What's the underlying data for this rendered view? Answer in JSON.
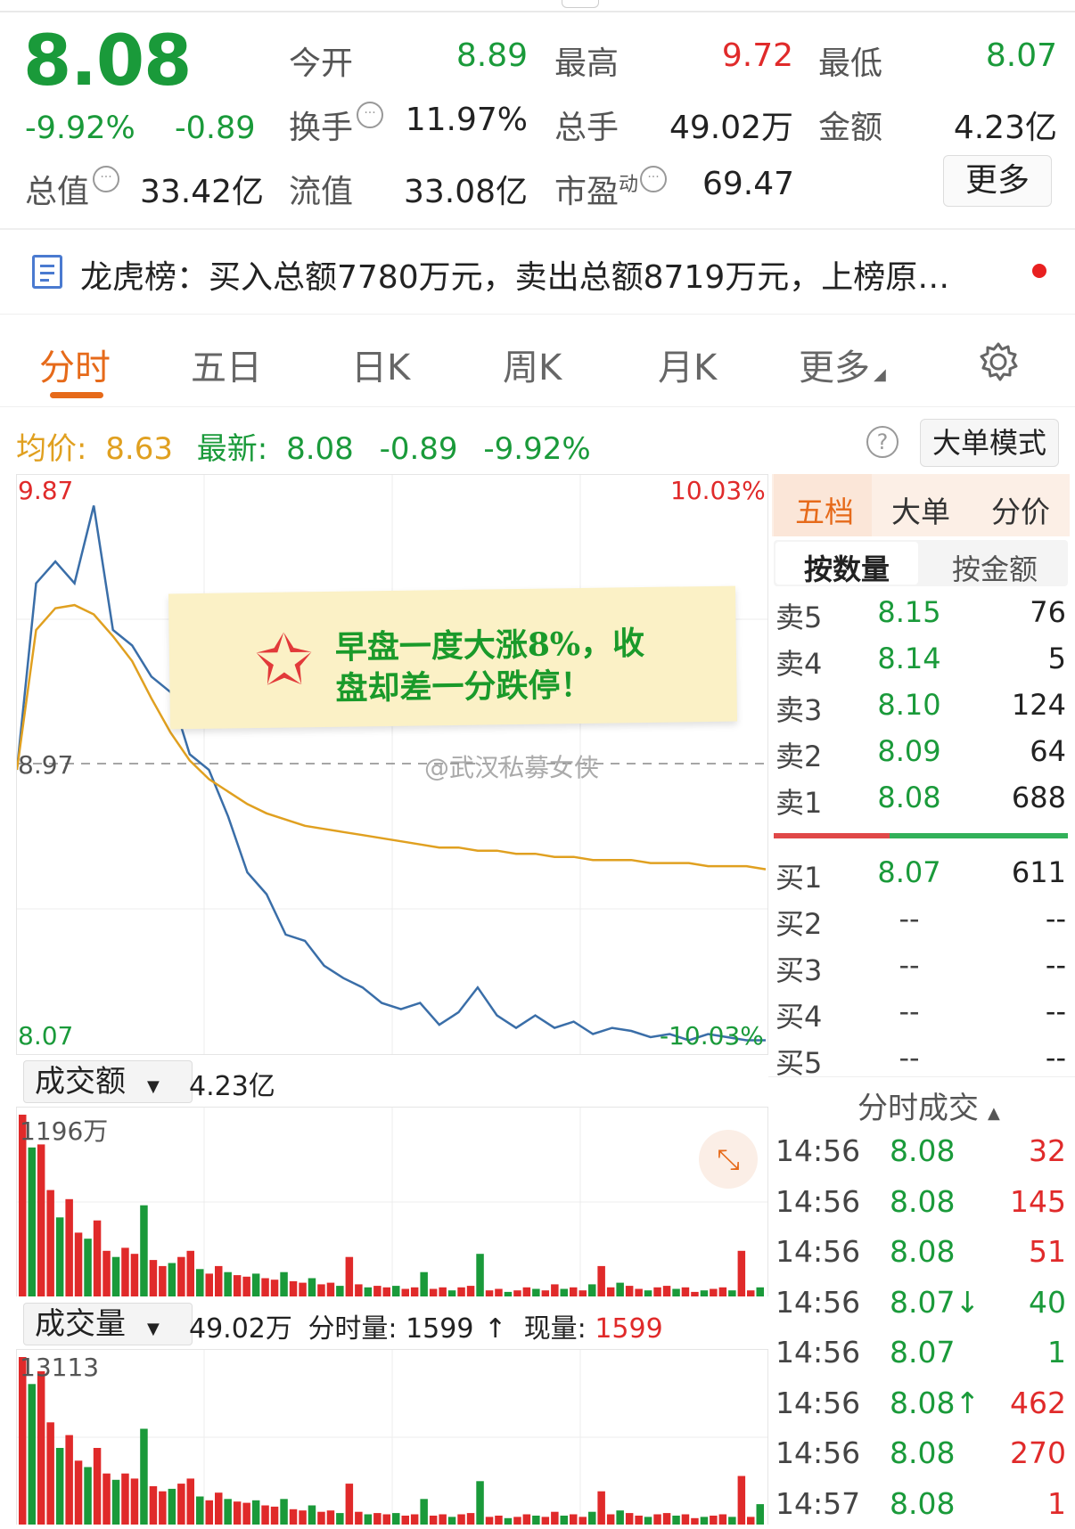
{
  "quote": {
    "price": "8.08",
    "change_pct": "-9.92%",
    "change": "-0.89",
    "open_label": "今开",
    "open": "8.89",
    "high_label": "最高",
    "high": "9.72",
    "low_label": "最低",
    "low": "8.07",
    "turnover_label": "换手",
    "turnover": "11.97%",
    "volume_label": "总手",
    "volume": "49.02万",
    "amount_label": "金额",
    "amount": "4.23亿",
    "mktcap_label": "总值",
    "mktcap": "33.42亿",
    "float_label": "流值",
    "float_cap": "33.08亿",
    "pe_label": "市盈",
    "pe_sup": "动",
    "pe": "69.47",
    "more_label": "更多"
  },
  "banner": {
    "text": "龙虎榜：买入总额7780万元，卖出总额8719万元，上榜原…"
  },
  "tabs": [
    "分时",
    "五日",
    "日K",
    "周K",
    "月K",
    "更多"
  ],
  "stats_line": {
    "avg_label": "均价:",
    "avg": "8.63",
    "latest_label": "最新:",
    "latest": "8.08",
    "change": "-0.89",
    "change_pct": "-9.92%",
    "mode_btn": "大单模式"
  },
  "chart_labels": {
    "top_price": "9.87",
    "mid_price": "8.97",
    "bottom_price": "8.07",
    "top_pct": "10.03%",
    "bottom_pct": "-10.03%",
    "watermark": "@武汉私募女侠"
  },
  "sticky_note": {
    "line1": "早盘一度大涨8%，收",
    "line2": "盘却差一分跌停！"
  },
  "amount_panel": {
    "selector": "成交额",
    "value": "4.23亿",
    "max_label": "1196万"
  },
  "volume_panel": {
    "selector": "成交量",
    "value": "49.02万",
    "tick_vol_label": "分时量:",
    "tick_vol": "1599",
    "now_label": "现量:",
    "now_vol": "1599",
    "max_label": "13113"
  },
  "side_tabs": [
    "五档",
    "大单",
    "分价"
  ],
  "side_subtabs": [
    "按数量",
    "按金额"
  ],
  "order_book": {
    "asks": [
      {
        "label": "卖5",
        "price": "8.15",
        "qty": "76"
      },
      {
        "label": "卖4",
        "price": "8.14",
        "qty": "5"
      },
      {
        "label": "卖3",
        "price": "8.10",
        "qty": "124"
      },
      {
        "label": "卖2",
        "price": "8.09",
        "qty": "64"
      },
      {
        "label": "卖1",
        "price": "8.08",
        "qty": "688"
      }
    ],
    "bids": [
      {
        "label": "买1",
        "price": "8.07",
        "qty": "611"
      },
      {
        "label": "买2",
        "price": "--",
        "qty": "--"
      },
      {
        "label": "买3",
        "price": "--",
        "qty": "--"
      },
      {
        "label": "买4",
        "price": "--",
        "qty": "--"
      },
      {
        "label": "买5",
        "price": "--",
        "qty": "--"
      }
    ]
  },
  "trades_title": "分时成交",
  "trades": [
    {
      "time": "14:56",
      "price": "8.08",
      "qty": "32",
      "qty_color": "red"
    },
    {
      "time": "14:56",
      "price": "8.08",
      "qty": "145",
      "qty_color": "red"
    },
    {
      "time": "14:56",
      "price": "8.08",
      "qty": "51",
      "qty_color": "red"
    },
    {
      "time": "14:56",
      "price": "8.07↓",
      "qty": "40",
      "qty_color": "green"
    },
    {
      "time": "14:56",
      "price": "8.07",
      "qty": "1",
      "qty_color": "green"
    },
    {
      "time": "14:56",
      "price": "8.08↑",
      "qty": "462",
      "qty_color": "red"
    },
    {
      "time": "14:56",
      "price": "8.08",
      "qty": "270",
      "qty_color": "red"
    },
    {
      "time": "14:57",
      "price": "8.08",
      "qty": "1",
      "qty_color": "red"
    }
  ],
  "colors": {
    "up": "#e02a2a",
    "down": "#1a9a3a",
    "avg_line": "#e0a020",
    "price_line": "#3a6ea8",
    "accent": "#e66a1a"
  },
  "chart_data": {
    "type": "line",
    "title": "",
    "ylim": [
      8.07,
      9.87
    ],
    "prev_close": 8.97,
    "series": [
      {
        "name": "price",
        "values": [
          8.95,
          9.55,
          9.62,
          9.55,
          9.8,
          9.4,
          9.35,
          9.25,
          9.2,
          9.0,
          8.95,
          8.8,
          8.62,
          8.55,
          8.42,
          8.4,
          8.32,
          8.28,
          8.25,
          8.2,
          8.18,
          8.2,
          8.13,
          8.17,
          8.25,
          8.16,
          8.12,
          8.16,
          8.12,
          8.14,
          8.1,
          8.12,
          8.11,
          8.09,
          8.1,
          8.08,
          8.1,
          8.09,
          8.08,
          8.08
        ]
      },
      {
        "name": "avg",
        "values": [
          8.95,
          9.4,
          9.47,
          9.48,
          9.45,
          9.38,
          9.3,
          9.18,
          9.07,
          8.98,
          8.92,
          8.88,
          8.84,
          8.81,
          8.79,
          8.77,
          8.76,
          8.75,
          8.74,
          8.73,
          8.72,
          8.71,
          8.7,
          8.7,
          8.69,
          8.69,
          8.68,
          8.68,
          8.67,
          8.67,
          8.66,
          8.66,
          8.66,
          8.65,
          8.65,
          8.65,
          8.64,
          8.64,
          8.64,
          8.63
        ]
      }
    ],
    "amount_bars": [
      1196,
      980,
      1000,
      700,
      520,
      640,
      420,
      380,
      500,
      300,
      260,
      320,
      280,
      600,
      240,
      200,
      220,
      260,
      300,
      180,
      150,
      200,
      160,
      140,
      130,
      150,
      120,
      110,
      160,
      100,
      90,
      120,
      80,
      90,
      70,
      260,
      80,
      60,
      70,
      60,
      70,
      50,
      60,
      160,
      50,
      60,
      40,
      60,
      70,
      280,
      40,
      50,
      30,
      40,
      60,
      50,
      40,
      80,
      50,
      60,
      40,
      80,
      200,
      60,
      90,
      70,
      50,
      40,
      60,
      70,
      50,
      60,
      30,
      40,
      50,
      60,
      40,
      300,
      40,
      60
    ],
    "volume_bars": [
      13113,
      11000,
      12000,
      8000,
      6000,
      7000,
      5000,
      4500,
      6000,
      4000,
      3500,
      4000,
      3600,
      7500,
      3000,
      2600,
      2800,
      3200,
      3600,
      2200,
      1900,
      2500,
      2000,
      1800,
      1700,
      1900,
      1500,
      1400,
      2000,
      1200,
      1100,
      1500,
      1000,
      1100,
      900,
      3200,
      1000,
      800,
      900,
      800,
      900,
      700,
      800,
      2000,
      700,
      800,
      600,
      800,
      900,
      3400,
      600,
      700,
      500,
      600,
      800,
      700,
      600,
      1000,
      700,
      800,
      600,
      1000,
      2600,
      800,
      1100,
      900,
      700,
      600,
      800,
      900,
      700,
      800,
      500,
      600,
      700,
      800,
      600,
      3800,
      600,
      1599
    ]
  }
}
